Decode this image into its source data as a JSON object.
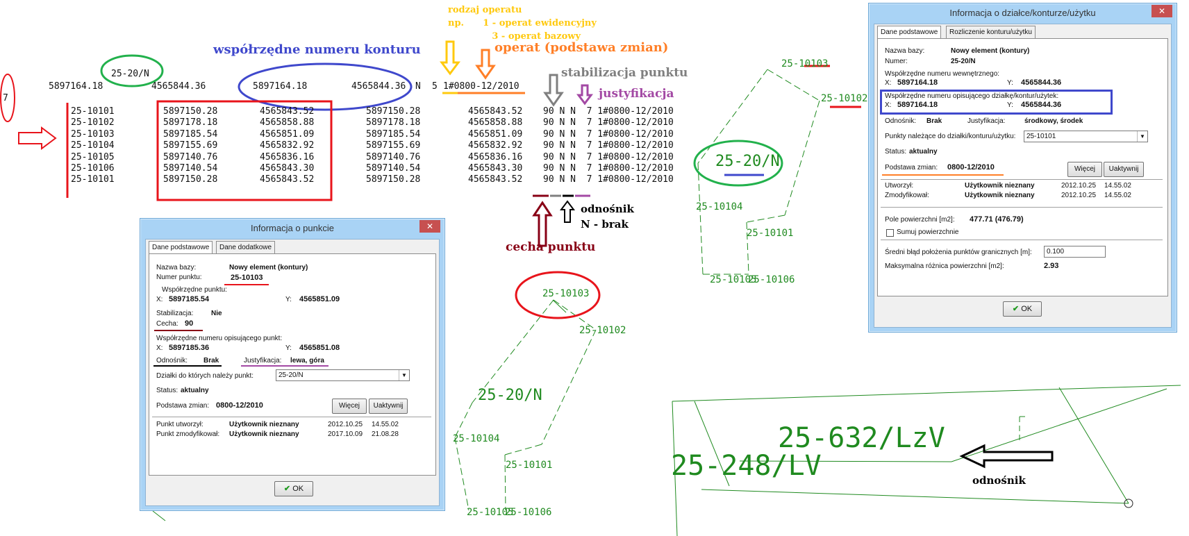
{
  "header": {
    "line_value_7": "7",
    "code_label": "25-20/N",
    "x1": "5897164.18",
    "y1": "4565844.36",
    "x2": "5897164.18",
    "y2": "4565844.36",
    "code_tail": "N",
    "op_prefix": "5",
    "operat": "1#0800-12/2010"
  },
  "annotations": {
    "rodzaj": [
      "rodzaj operatu",
      "np.      1 - operat ewidencyjny",
      "              3 - operat bazowy"
    ],
    "wspolrzedne": "współrzędne numeru konturu",
    "operat": "operat (podstawa zmian)",
    "stabilizacja": "stabilizacja punktu",
    "justyfikacja": "justyfikacja",
    "odnosnik_title": "odnośnik",
    "odnosnik_sub": "N - brak",
    "cecha": "cecha punktu",
    "odnosnik2": "odnośnik"
  },
  "points_table": {
    "rows": [
      [
        "25-10101",
        "5897150.28",
        "4565843.52",
        "5897150.28",
        "4565843.52",
        "90 N N  7 1#0800-12/2010"
      ],
      [
        "25-10102",
        "5897178.18",
        "4565858.88",
        "5897178.18",
        "4565858.88",
        "90 N N  7 1#0800-12/2010"
      ],
      [
        "25-10103",
        "5897185.54",
        "4565851.09",
        "5897185.54",
        "4565851.09",
        "90 N N  7 1#0800-12/2010"
      ],
      [
        "25-10104",
        "5897155.69",
        "4565832.92",
        "5897155.69",
        "4565832.92",
        "90 N N  7 1#0800-12/2010"
      ],
      [
        "25-10105",
        "5897140.76",
        "4565836.16",
        "5897140.76",
        "4565836.16",
        "90 N N  7 1#0800-12/2010"
      ],
      [
        "25-10106",
        "5897140.54",
        "4565843.30",
        "5897140.54",
        "4565843.30",
        "90 N N  7 1#0800-12/2010"
      ],
      [
        "25-10101",
        "5897150.28",
        "4565843.52",
        "5897150.28",
        "4565843.52",
        "90 N N  7 1#0800-12/2010"
      ]
    ]
  },
  "dialog_point": {
    "title": "Informacja o punkcie",
    "close": "✕",
    "tabs": [
      "Dane podstawowe",
      "Dane dodatkowe"
    ],
    "nazwa_label": "Nazwa bazy:",
    "nazwa_value": "Nowy element (kontury)",
    "numer_label": "Numer punktu:",
    "numer_value": "25-10103",
    "wsp_label": "Współrzędne punktu:",
    "x_label": "X:",
    "x_value": "5897185.54",
    "y_label": "Y:",
    "y_value": "4565851.09",
    "stab_label": "Stabilizacja:",
    "stab_value": "Nie",
    "cecha_label": "Cecha:",
    "cecha_value": "90",
    "wsp2_label": "Współrzędne numeru opisującego punkt:",
    "x2_value": "5897185.36",
    "y2_value": "4565851.08",
    "odn_label": "Odnośnik:",
    "odn_value": "Brak",
    "just_label": "Justyfikacja:",
    "just_value": "lewa, góra",
    "dzialki_label": "Działki do których należy punkt:",
    "dzialki_value": "25-20/N",
    "status_label": "Status:",
    "status_value": "aktualny",
    "podstawa_label": "Podstawa zmian:",
    "podstawa_value": "0800-12/2010",
    "wiecej": "Więcej",
    "uaktywnij": "Uaktywnij",
    "utworzyl_label": "Punkt utworzył:",
    "utworzyl_value": "Użytkownik nieznany",
    "utworzyl_date": "2012.10.25",
    "utworzyl_time": "14.55.02",
    "zmod_label": "Punkt zmodyfikował:",
    "zmod_value": "Użytkownik nieznany",
    "zmod_date": "2017.10.09",
    "zmod_time": "21.08.28",
    "ok": "OK"
  },
  "dialog_parcel": {
    "title": "Informacja o działce/konturze/użytku",
    "close": "✕",
    "tabs": [
      "Dane podstawowe",
      "Rozliczenie konturu/użytku"
    ],
    "nazwa_label": "Nazwa bazy:",
    "nazwa_value": "Nowy element (kontury)",
    "numer_label": "Numer:",
    "numer_value": "25-20/N",
    "wsp_wew_label": "Współrzędne numeru wewnętrznego:",
    "x_label": "X:",
    "x_value": "5897164.18",
    "y_label": "Y:",
    "y_value": "4565844.36",
    "wsp_opis_label": "Współrzędne numeru opisującego działkę/kontur/użytek:",
    "x2_value": "5897164.18",
    "y2_value": "4565844.36",
    "odn_label": "Odnośnik:",
    "odn_value": "Brak",
    "just_label": "Justyfikacja:",
    "just_value": "środkowy, środek",
    "punkty_label": "Punkty należące do działki/konturu/użytku:",
    "punkty_value": "25-10101",
    "status_label": "Status:",
    "status_value": "aktualny",
    "podstawa_label": "Podstawa zmian:",
    "podstawa_value": "0800-12/2010",
    "wiecej": "Więcej",
    "uaktywnij": "Uaktywnij",
    "utworzyl_label": "Utworzył:",
    "utworzyl_value": "Użytkownik nieznany",
    "utworzyl_date": "2012.10.25",
    "utworzyl_time": "14.55.02",
    "zmod_label": "Zmodyfikował:",
    "zmod_value": "Użytkownik nieznany",
    "zmod_date": "2012.10.25",
    "zmod_time": "14.55.02",
    "pole_label": "Pole powierzchni [m2]:",
    "pole_value": "477.71 (476.79)",
    "sumuj_label": "Sumuj powierzchnie",
    "blad_label": "Średni błąd położenia punktów granicznych [m]:",
    "blad_value": "0.100",
    "maks_label": "Maksymalna  różnica powierzchni [m2]:",
    "maks_value": "2.93",
    "ok": "OK"
  },
  "cad_top": {
    "p10103": "25-10103",
    "p10102": "25-10102",
    "parcel": "25-20/N",
    "p10104": "25-10104",
    "p10101": "25-10101",
    "p10105": "25-10105",
    "p10106": "25-10106"
  },
  "cad_mid": {
    "p10103": "25-10103",
    "p10102": "25-10102",
    "parcel": "25-20/N",
    "p10104": "25-10104",
    "p10101": "25-10101",
    "p10105": "25-10105",
    "p10106": "25-10106"
  },
  "cad_bottom": {
    "label_a": "25-632/LzV",
    "label_b": "25-248/LV"
  },
  "colors": {
    "red": "#e8141b",
    "green": "#22b14c",
    "blue": "#3f48cc",
    "orange": "#ff7f27",
    "yellow": "#ffc90e",
    "gray": "#7f7f7f",
    "purple": "#a349a4",
    "maroon": "#880015",
    "cad_green": "#1f8a1f"
  }
}
